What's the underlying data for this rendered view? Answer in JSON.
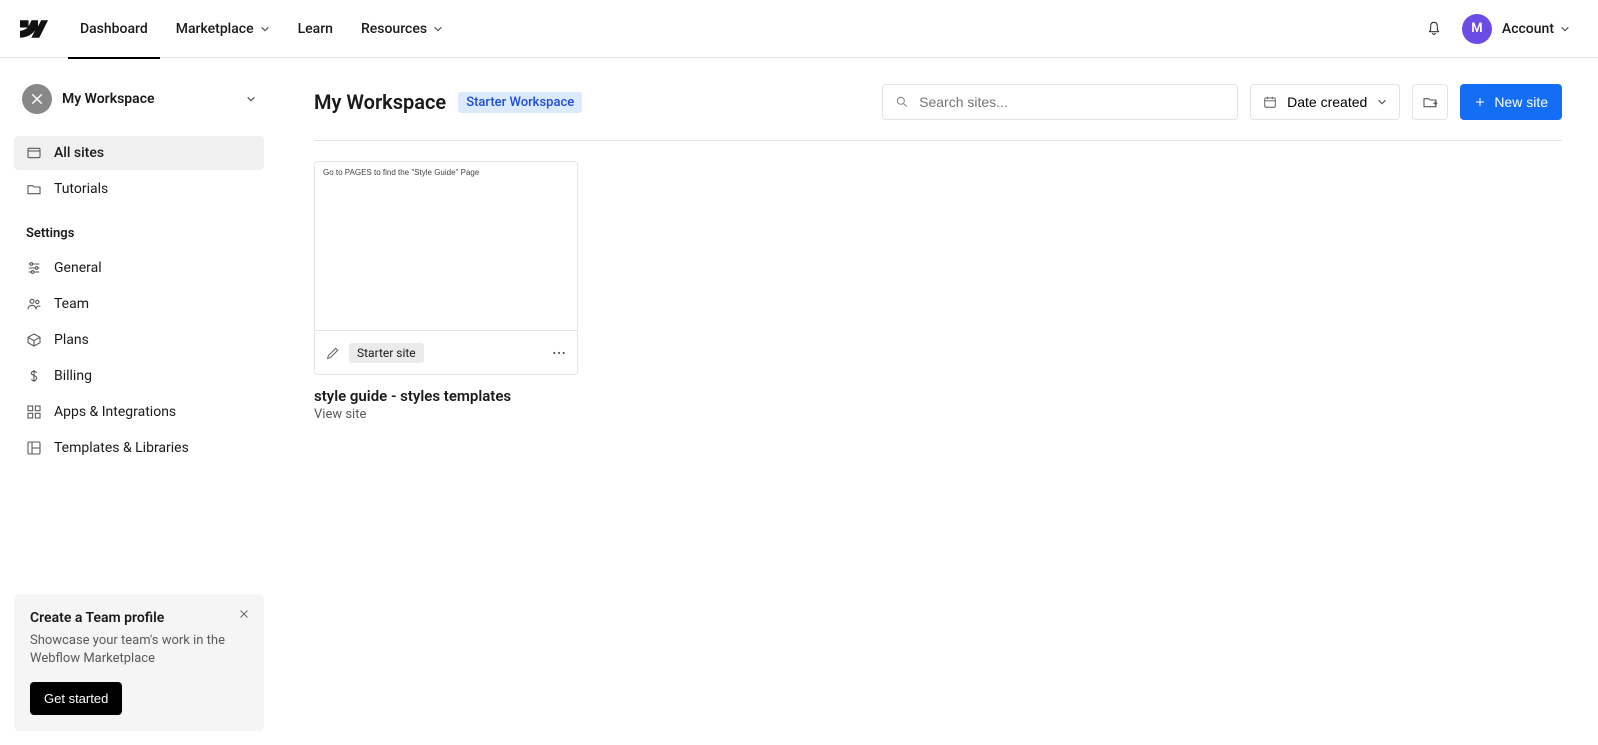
{
  "topnav": {
    "items": [
      {
        "label": "Dashboard"
      },
      {
        "label": "Marketplace"
      },
      {
        "label": "Learn"
      },
      {
        "label": "Resources"
      }
    ],
    "avatar_initial": "M",
    "account_label": "Account"
  },
  "sidebar": {
    "workspace_name": "My Workspace",
    "nav": [
      {
        "label": "All sites"
      },
      {
        "label": "Tutorials"
      }
    ],
    "settings_heading": "Settings",
    "settings": [
      {
        "label": "General"
      },
      {
        "label": "Team"
      },
      {
        "label": "Plans"
      },
      {
        "label": "Billing"
      },
      {
        "label": "Apps & Integrations"
      },
      {
        "label": "Templates & Libraries"
      }
    ],
    "promo": {
      "title": "Create a Team profile",
      "body": "Showcase your team's work in the Webflow Marketplace",
      "cta": "Get started"
    }
  },
  "header": {
    "title": "My Workspace",
    "tier_badge": "Starter Workspace",
    "search_placeholder": "Search sites...",
    "sort_label": "Date created",
    "new_site_label": "New site"
  },
  "sites": [
    {
      "thumb_caption": "Go to PAGES to find the \"Style Guide\" Page",
      "badge": "Starter site",
      "title": "style guide - styles templates",
      "view_label": "View site"
    }
  ]
}
